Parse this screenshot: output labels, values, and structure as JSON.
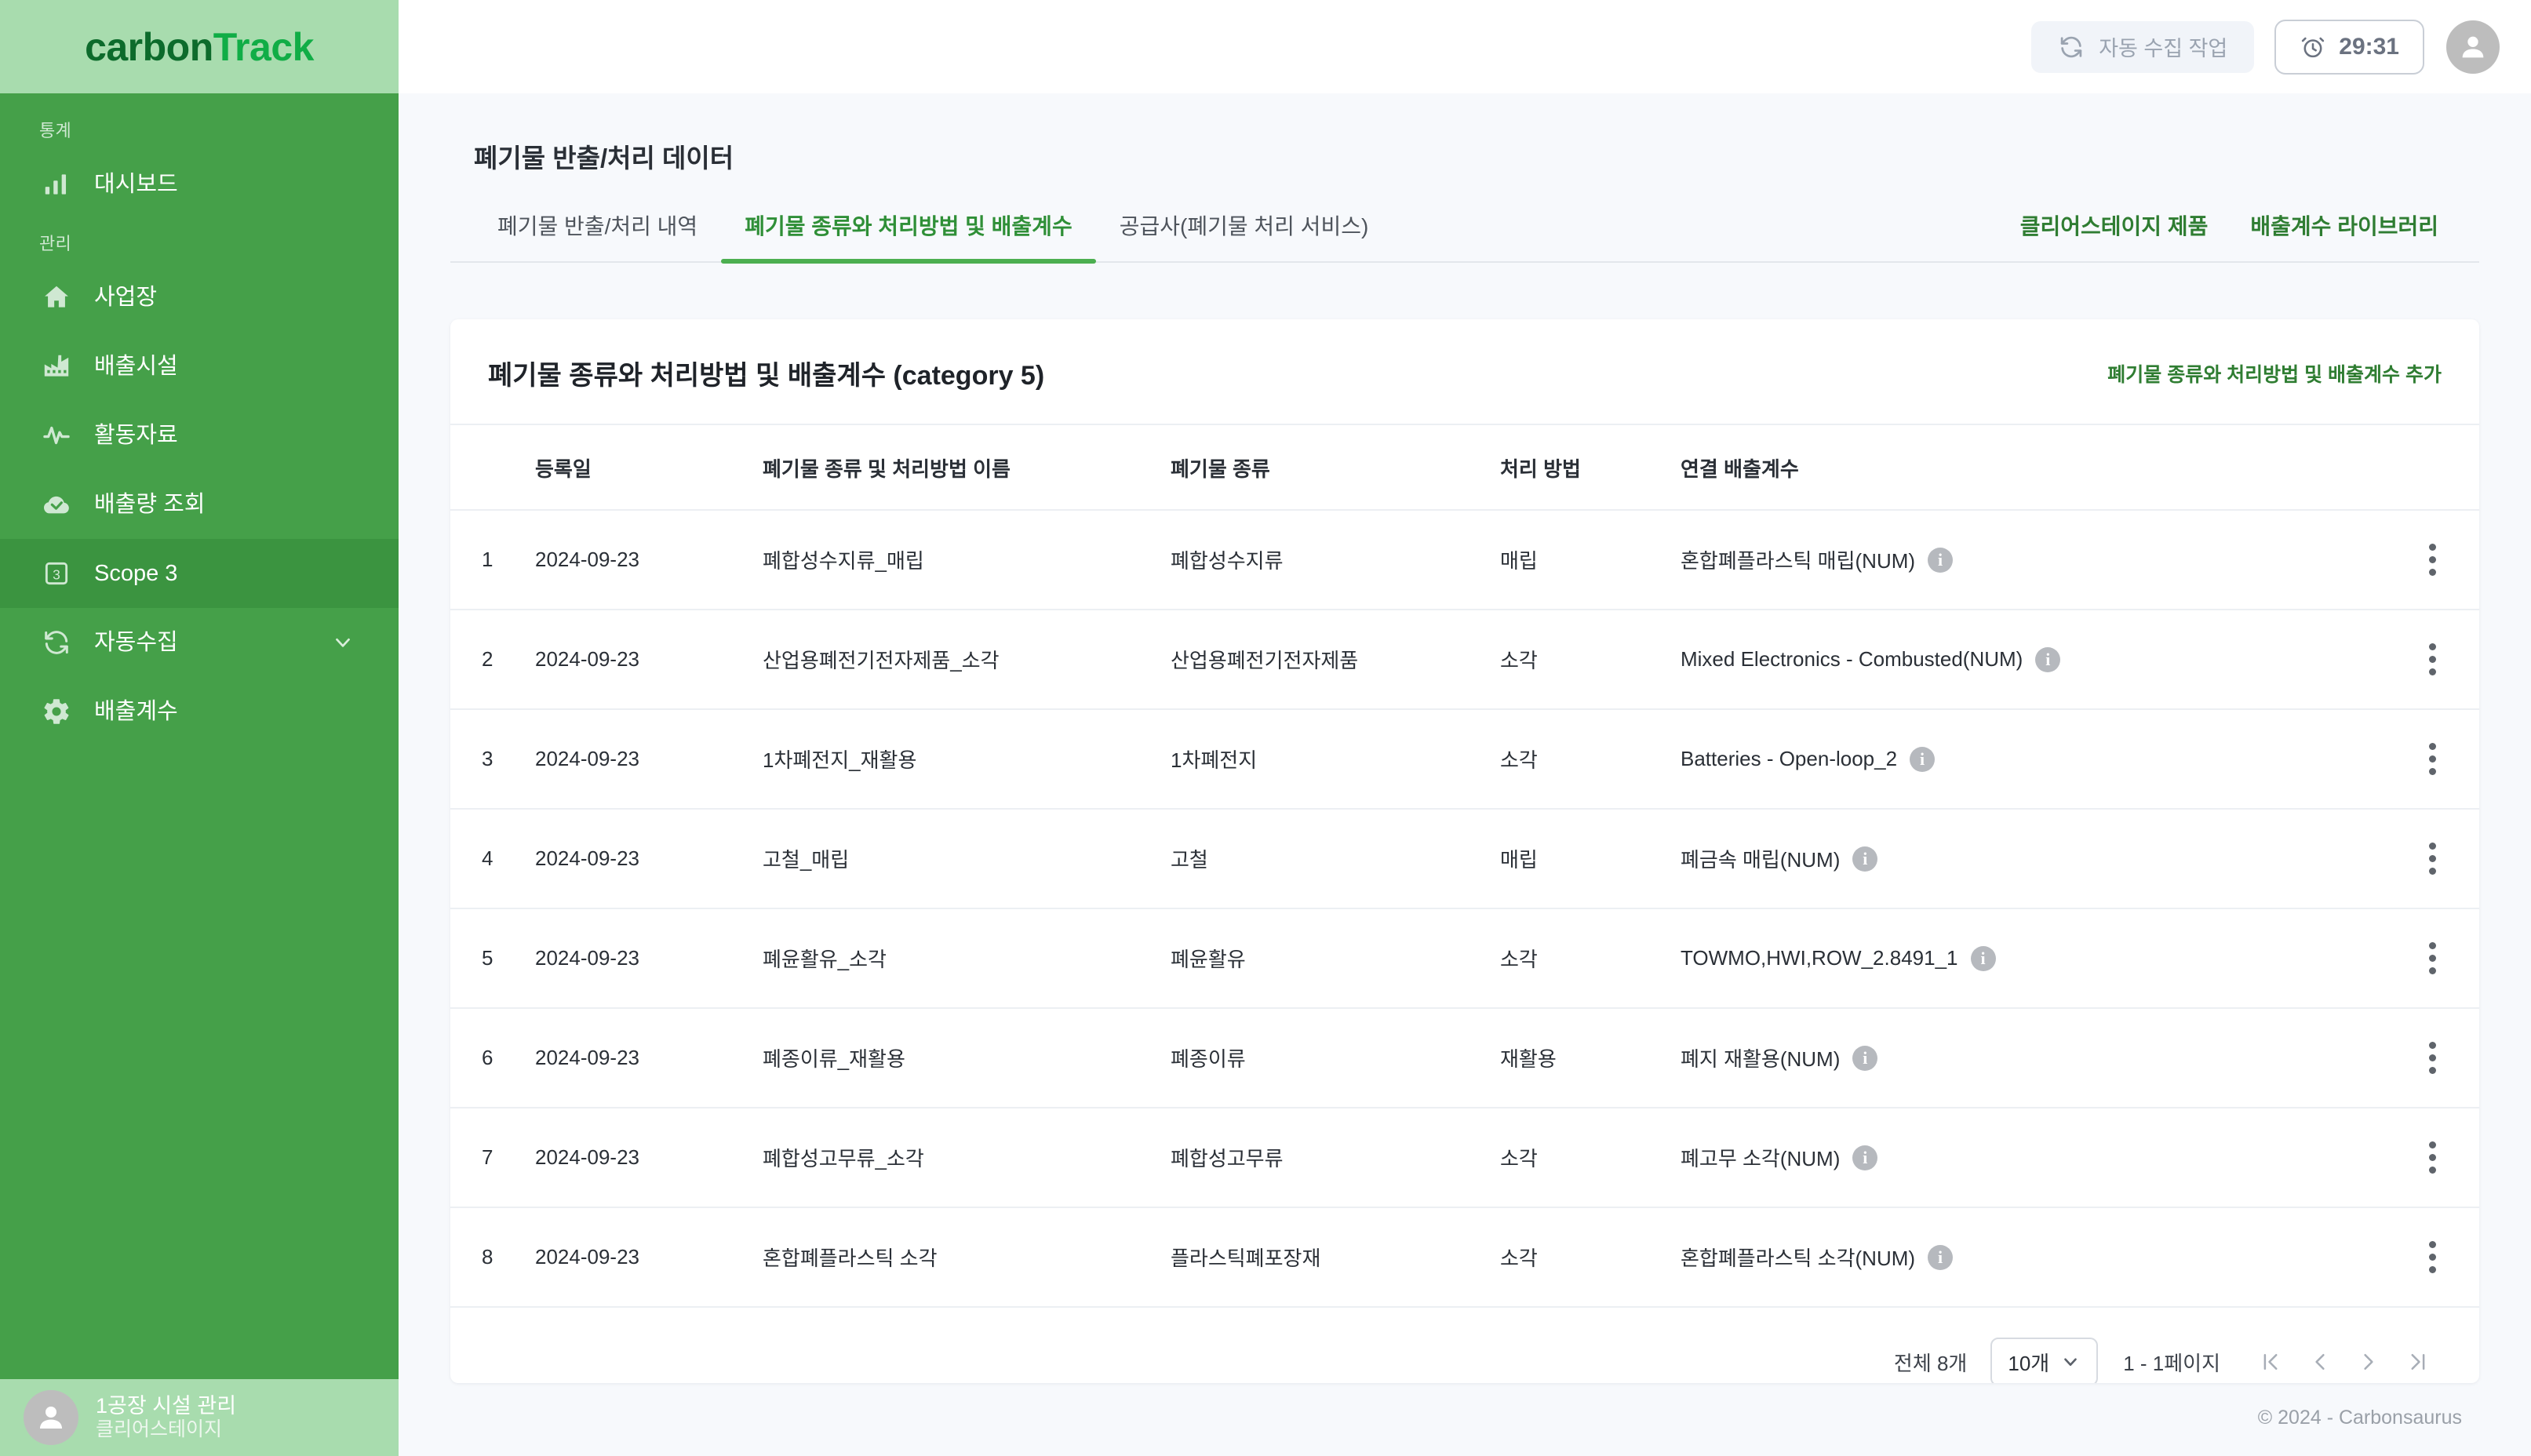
{
  "brand": {
    "part1": "carbon",
    "part2": "Track"
  },
  "sidebar": {
    "sections": [
      {
        "label": "통계",
        "items": [
          {
            "label": "대시보드",
            "icon": "bar-chart-icon",
            "active": false
          }
        ]
      },
      {
        "label": "관리",
        "items": [
          {
            "label": "사업장",
            "icon": "home-icon",
            "active": false
          },
          {
            "label": "배출시설",
            "icon": "factory-icon",
            "active": false
          },
          {
            "label": "활동자료",
            "icon": "activity-icon",
            "active": false
          },
          {
            "label": "배출량 조회",
            "icon": "cloud-icon",
            "active": false
          },
          {
            "label": "Scope 3",
            "icon": "scope3-icon",
            "active": true
          },
          {
            "label": "자동수집",
            "icon": "refresh-icon",
            "active": false,
            "expandable": true
          },
          {
            "label": "배출계수",
            "icon": "gear-icon",
            "active": false
          }
        ]
      }
    ],
    "user": {
      "name": "1공장 시설 관리",
      "org": "클리어스테이지"
    }
  },
  "topbar": {
    "ghost_items": [
      "",
      "",
      "",
      "",
      "",
      "",
      ""
    ],
    "auto_collect_label": "자동 수집 작업",
    "timer_value": "29:31"
  },
  "page": {
    "title": "폐기물 반출/처리 데이터"
  },
  "tabs": {
    "left": [
      {
        "label": "폐기물 반출/처리 내역",
        "active": false
      },
      {
        "label": "폐기물 종류와 처리방법 및 배출계수",
        "active": true
      },
      {
        "label": "공급사(폐기물 처리 서비스)",
        "active": false
      }
    ],
    "right": [
      {
        "label": "클리어스테이지 제품"
      },
      {
        "label": "배출계수 라이브러리"
      }
    ]
  },
  "card": {
    "title": "폐기물 종류와 처리방법 및 배출계수 (category 5)",
    "action_label": "폐기물 종류와 처리방법 및 배출계수 추가"
  },
  "table": {
    "columns": [
      "",
      "등록일",
      "폐기물 종류 및 처리방법 이름",
      "폐기물 종류",
      "처리 방법",
      "연결 배출계수",
      ""
    ],
    "rows": [
      {
        "idx": "1",
        "date": "2024-09-23",
        "name": "폐합성수지류_매립",
        "type": "폐합성수지류",
        "method": "매립",
        "ef": "혼합폐플라스틱 매립(NUM)"
      },
      {
        "idx": "2",
        "date": "2024-09-23",
        "name": "산업용폐전기전자제품_소각",
        "type": "산업용폐전기전자제품",
        "method": "소각",
        "ef": "Mixed Electronics - Combusted(NUM)"
      },
      {
        "idx": "3",
        "date": "2024-09-23",
        "name": "1차폐전지_재활용",
        "type": "1차폐전지",
        "method": "소각",
        "ef": "Batteries - Open-loop_2"
      },
      {
        "idx": "4",
        "date": "2024-09-23",
        "name": "고철_매립",
        "type": "고철",
        "method": "매립",
        "ef": "폐금속 매립(NUM)"
      },
      {
        "idx": "5",
        "date": "2024-09-23",
        "name": "폐윤활유_소각",
        "type": "폐윤활유",
        "method": "소각",
        "ef": "TOWMO,HWI,ROW_2.8491_1"
      },
      {
        "idx": "6",
        "date": "2024-09-23",
        "name": "폐종이류_재활용",
        "type": "폐종이류",
        "method": "재활용",
        "ef": "폐지 재활용(NUM)"
      },
      {
        "idx": "7",
        "date": "2024-09-23",
        "name": "폐합성고무류_소각",
        "type": "폐합성고무류",
        "method": "소각",
        "ef": "폐고무 소각(NUM)"
      },
      {
        "idx": "8",
        "date": "2024-09-23",
        "name": "혼합폐플라스틱 소각",
        "type": "플라스틱폐포장재",
        "method": "소각",
        "ef": "혼합폐플라스틱 소각(NUM)"
      }
    ]
  },
  "pagination": {
    "total_label": "전체 8개",
    "page_size": "10개",
    "range_label": "1 - 1페이지",
    "first_icon": "first-page-icon",
    "prev_icon": "prev-page-icon",
    "next_icon": "next-page-icon",
    "last_icon": "last-page-icon"
  },
  "footer": {
    "copyright": "© 2024 - Carbonsaurus"
  },
  "colors": {
    "sidebar_bg": "#45a049",
    "sidebar_active": "#3b9440",
    "brand_bg": "#a8dcae",
    "accent_green": "#4caf50",
    "link_green": "#2f7d32",
    "content_bg": "#f7f9fc"
  }
}
